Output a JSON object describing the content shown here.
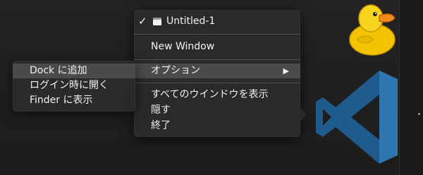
{
  "main_menu": {
    "window_item": "Untitled-1",
    "checkmark": "✓",
    "new_window": "New Window",
    "options": "オプション",
    "options_arrow": "▶",
    "show_all_windows": "すべてのウインドウを表示",
    "hide": "隠す",
    "quit": "終了"
  },
  "submenu": {
    "items": [
      {
        "label": "Dock に追加"
      },
      {
        "label": "ログイン時に開く"
      },
      {
        "label": "Finder に表示"
      }
    ]
  },
  "dock_icons": {
    "app_icon": "vscode-icon",
    "other_icon": "duck-icon"
  },
  "colors": {
    "menu_bg": "#2a2a2a",
    "highlight": "#4a4a4a",
    "vscode_blue": "#1f5b8d",
    "duck_yellow": "#f7d51f"
  }
}
